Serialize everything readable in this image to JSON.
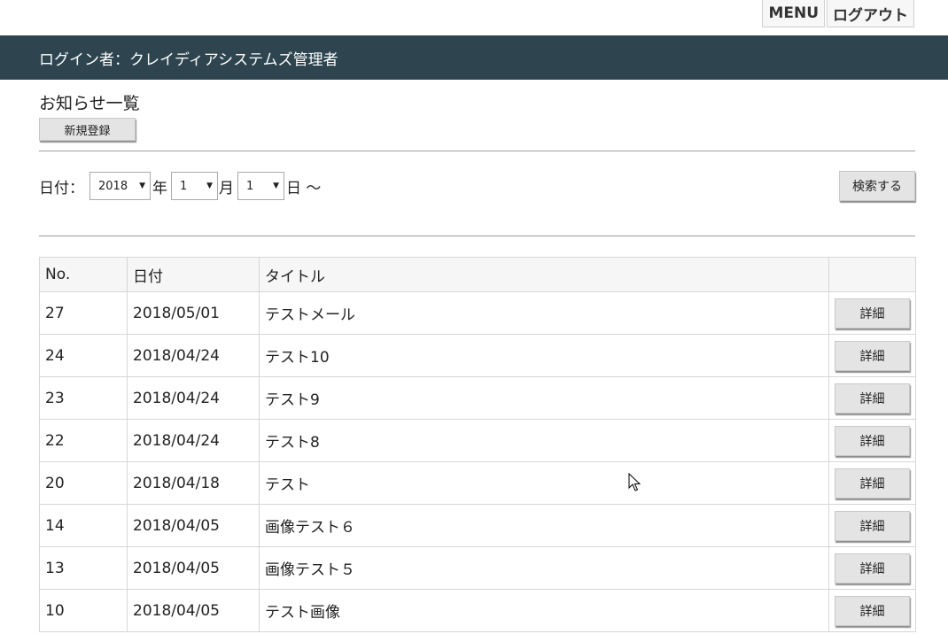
{
  "top_nav": {
    "menu_label": "MENU",
    "logout_label": "ログアウト"
  },
  "header": {
    "login_text": "ログイン者：クレイディアシステムズ管理者"
  },
  "page": {
    "title": "お知らせ一覧",
    "new_button": "新規登録"
  },
  "search": {
    "date_label": "日付：",
    "year_value": "2018",
    "year_unit": "年",
    "month_value": "1",
    "month_unit": "月",
    "day_value": "1",
    "day_unit": "日 ～",
    "search_button": "検索する"
  },
  "table": {
    "headers": [
      "No.",
      "日付",
      "タイトル",
      ""
    ],
    "rows": [
      {
        "no": "27",
        "date": "2018/05/01",
        "title": "テストメール",
        "action": "詳細"
      },
      {
        "no": "24",
        "date": "2018/04/24",
        "title": "テスト10",
        "action": "詳細"
      },
      {
        "no": "23",
        "date": "2018/04/24",
        "title": "テスト9",
        "action": "詳細"
      },
      {
        "no": "22",
        "date": "2018/04/24",
        "title": "テスト8",
        "action": "詳細"
      },
      {
        "no": "20",
        "date": "2018/04/18",
        "title": "テスト",
        "action": "詳細"
      },
      {
        "no": "14",
        "date": "2018/04/05",
        "title": "画像テスト６",
        "action": "詳細"
      },
      {
        "no": "13",
        "date": "2018/04/05",
        "title": "画像テスト５",
        "action": "詳細"
      },
      {
        "no": "10",
        "date": "2018/04/05",
        "title": "テスト画像",
        "action": "詳細"
      }
    ]
  },
  "colors": {
    "header_bg": "#2e4550",
    "button_bg": "#e4e4e4"
  },
  "icons": {
    "cursor": "mouse-pointer-icon"
  }
}
